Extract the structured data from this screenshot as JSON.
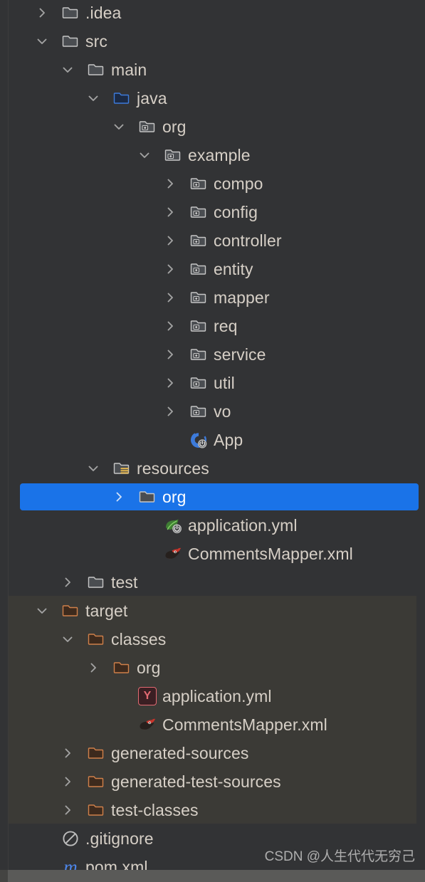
{
  "panel": {
    "name": "project-tool-window",
    "background": "#323335",
    "excluded_band_color": "#3b3a36",
    "selection_color": "#1a73e8",
    "text_color": "#d6cfc6"
  },
  "tree": {
    "rows": [
      {
        "label": ".idea",
        "depth": 1,
        "icon": "folder-icon",
        "arrow": "collapsed",
        "selected": false,
        "excluded": false
      },
      {
        "label": "src",
        "depth": 1,
        "icon": "folder-icon",
        "arrow": "expanded",
        "selected": false,
        "excluded": false
      },
      {
        "label": "main",
        "depth": 2,
        "icon": "folder-icon",
        "arrow": "expanded",
        "selected": false,
        "excluded": false
      },
      {
        "label": "java",
        "depth": 3,
        "icon": "source-root-icon",
        "arrow": "expanded",
        "selected": false,
        "excluded": false
      },
      {
        "label": "org",
        "depth": 4,
        "icon": "package-icon",
        "arrow": "expanded",
        "selected": false,
        "excluded": false
      },
      {
        "label": "example",
        "depth": 5,
        "icon": "package-icon",
        "arrow": "expanded",
        "selected": false,
        "excluded": false
      },
      {
        "label": "compo",
        "depth": 6,
        "icon": "package-icon",
        "arrow": "collapsed",
        "selected": false,
        "excluded": false
      },
      {
        "label": "config",
        "depth": 6,
        "icon": "package-icon",
        "arrow": "collapsed",
        "selected": false,
        "excluded": false
      },
      {
        "label": "controller",
        "depth": 6,
        "icon": "package-icon",
        "arrow": "collapsed",
        "selected": false,
        "excluded": false
      },
      {
        "label": "entity",
        "depth": 6,
        "icon": "package-icon",
        "arrow": "collapsed",
        "selected": false,
        "excluded": false
      },
      {
        "label": "mapper",
        "depth": 6,
        "icon": "package-icon",
        "arrow": "collapsed",
        "selected": false,
        "excluded": false
      },
      {
        "label": "req",
        "depth": 6,
        "icon": "package-icon",
        "arrow": "collapsed",
        "selected": false,
        "excluded": false
      },
      {
        "label": "service",
        "depth": 6,
        "icon": "package-icon",
        "arrow": "collapsed",
        "selected": false,
        "excluded": false
      },
      {
        "label": "util",
        "depth": 6,
        "icon": "package-icon",
        "arrow": "collapsed",
        "selected": false,
        "excluded": false
      },
      {
        "label": "vo",
        "depth": 6,
        "icon": "package-icon",
        "arrow": "collapsed",
        "selected": false,
        "excluded": false
      },
      {
        "label": "App",
        "depth": 6,
        "icon": "java-class-run-icon",
        "arrow": "none",
        "selected": false,
        "excluded": false
      },
      {
        "label": "resources",
        "depth": 3,
        "icon": "resource-root-icon",
        "arrow": "expanded",
        "selected": false,
        "excluded": false
      },
      {
        "label": "org",
        "depth": 4,
        "icon": "folder-icon",
        "arrow": "collapsed",
        "selected": true,
        "excluded": false
      },
      {
        "label": "application.yml",
        "depth": 5,
        "icon": "spring-yaml-icon",
        "arrow": "none",
        "selected": false,
        "excluded": false
      },
      {
        "label": "CommentsMapper.xml",
        "depth": 5,
        "icon": "mybatis-icon",
        "arrow": "none",
        "selected": false,
        "excluded": false
      },
      {
        "label": "test",
        "depth": 2,
        "icon": "folder-icon",
        "arrow": "collapsed",
        "selected": false,
        "excluded": false
      },
      {
        "label": "target",
        "depth": 1,
        "icon": "excluded-folder-icon",
        "arrow": "expanded",
        "selected": false,
        "excluded": true
      },
      {
        "label": "classes",
        "depth": 2,
        "icon": "excluded-folder-icon",
        "arrow": "expanded",
        "selected": false,
        "excluded": true
      },
      {
        "label": "org",
        "depth": 3,
        "icon": "excluded-folder-icon",
        "arrow": "collapsed",
        "selected": false,
        "excluded": true
      },
      {
        "label": "application.yml",
        "depth": 4,
        "icon": "yaml-file-icon",
        "arrow": "none",
        "selected": false,
        "excluded": true
      },
      {
        "label": "CommentsMapper.xml",
        "depth": 4,
        "icon": "mybatis-icon",
        "arrow": "none",
        "selected": false,
        "excluded": true
      },
      {
        "label": "generated-sources",
        "depth": 2,
        "icon": "excluded-folder-icon",
        "arrow": "collapsed",
        "selected": false,
        "excluded": true
      },
      {
        "label": "generated-test-sources",
        "depth": 2,
        "icon": "excluded-folder-icon",
        "arrow": "collapsed",
        "selected": false,
        "excluded": true
      },
      {
        "label": "test-classes",
        "depth": 2,
        "icon": "excluded-folder-icon",
        "arrow": "collapsed",
        "selected": false,
        "excluded": true
      },
      {
        "label": ".gitignore",
        "depth": 1,
        "icon": "gitignore-icon",
        "arrow": "none",
        "selected": false,
        "excluded": false
      },
      {
        "label": "pom.xml",
        "depth": 1,
        "icon": "maven-icon",
        "arrow": "none",
        "selected": false,
        "excluded": false
      }
    ]
  },
  "watermark": {
    "text": "CSDN @人生代代无穷己"
  }
}
